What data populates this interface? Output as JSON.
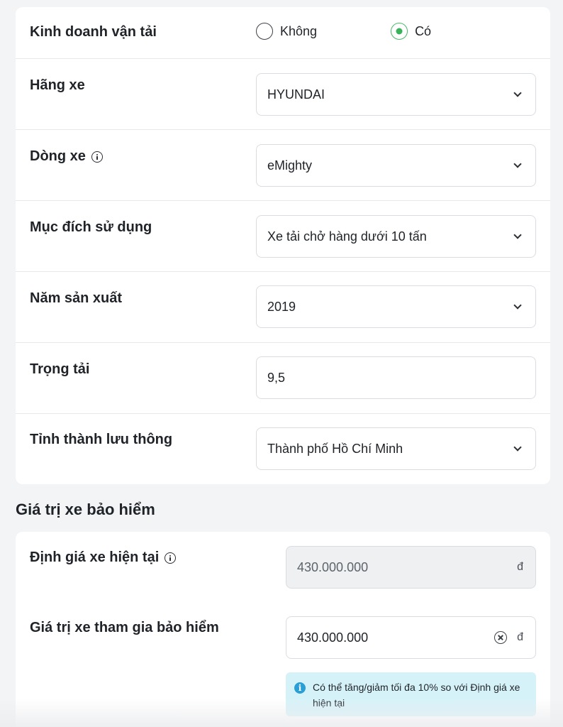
{
  "vehicle_form": {
    "business_transport": {
      "label": "Kinh doanh vận tải",
      "options": [
        "Không",
        "Có"
      ],
      "selected": "Có"
    },
    "brand": {
      "label": "Hãng xe",
      "value": "HYUNDAI"
    },
    "model": {
      "label": "Dòng xe",
      "value": "eMighty"
    },
    "purpose": {
      "label": "Mục đích sử dụng",
      "value": "Xe tải chở hàng dưới 10 tấn"
    },
    "year": {
      "label": "Năm sản xuất",
      "value": "2019"
    },
    "payload": {
      "label": "Trọng tải",
      "value": "9,5"
    },
    "province": {
      "label": "Tỉnh thành lưu thông",
      "value": "Thành phố Hồ Chí Minh"
    }
  },
  "insurance_value": {
    "title": "Giá trị xe bảo hiểm",
    "current_valuation": {
      "label": "Định giá xe hiện tại",
      "value": "430.000.000",
      "currency": "đ"
    },
    "insured_value": {
      "label": "Giá trị xe tham gia bảo hiểm",
      "value": "430.000.000",
      "currency": "đ"
    },
    "note": "Có thể tăng/giảm tối đa 10% so với Định giá xe hiện tại"
  },
  "colors": {
    "radio_checked": "#39b25c",
    "note_background": "#d6f2f9",
    "info_icon": "#2a9fd6"
  },
  "icons": {
    "info": "info-icon",
    "dropdown": "chevron-down-icon",
    "clear": "clear-icon"
  }
}
